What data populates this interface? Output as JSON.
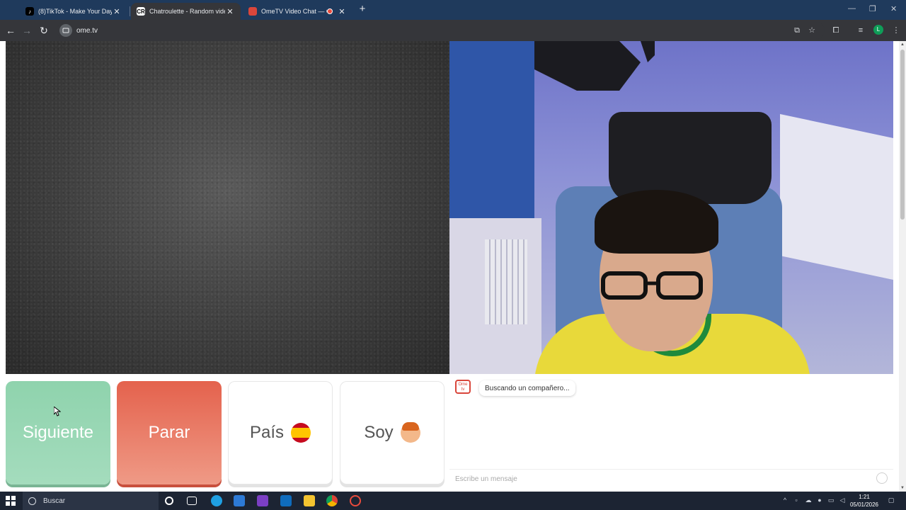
{
  "browser": {
    "tabs": [
      {
        "title": "(8)TikTok - Make Your Day",
        "favicon": "tiktok-icon",
        "active": false
      },
      {
        "title": "Chatroulette - Random video c",
        "favicon": "chatroulette-icon",
        "active": true
      },
      {
        "title": "OmeTV Video Chat — Ome",
        "favicon": "ometv-icon",
        "active": false
      }
    ],
    "url": "ome.tv",
    "profile_initial": "L"
  },
  "page": {
    "buttons": {
      "next": "Siguiente",
      "stop": "Parar",
      "country": "País",
      "soy": "Soy"
    },
    "chat": {
      "logo_text": "Ome tv",
      "status_message": "Buscando un compañero...",
      "input_placeholder": "Escribe un mensaje"
    }
  },
  "taskbar": {
    "search_label": "Buscar",
    "time": "1:21",
    "date": "05/01/2026"
  },
  "colors": {
    "next_button": "#8fd3ad",
    "stop_button": "#e4624d",
    "brand": "#d9463b"
  }
}
